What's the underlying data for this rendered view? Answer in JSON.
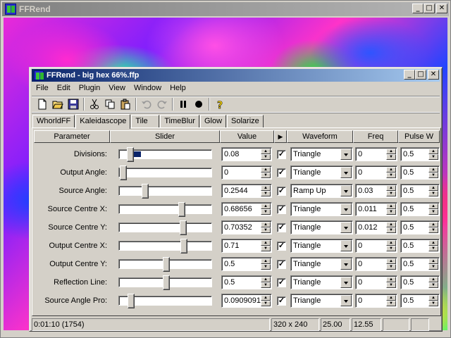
{
  "outer_window": {
    "title": "FFRend",
    "buttons": [
      "_",
      "□",
      "✕"
    ]
  },
  "window": {
    "title": "FFRend - big hex 66%.ffp",
    "buttons": [
      "_",
      "□",
      "✕"
    ]
  },
  "menu": [
    "File",
    "Edit",
    "Plugin",
    "View",
    "Window",
    "Help"
  ],
  "toolbar": [
    "new-file-icon",
    "open-folder-icon",
    "save-icon",
    "cut-icon",
    "copy-icon",
    "paste-icon",
    "undo-icon",
    "redo-icon",
    "pause-icon",
    "record-icon",
    "help-icon"
  ],
  "tabs": [
    "WhorldFF",
    "Kaleidascope",
    "Tile",
    "TimeBlur",
    "Glow",
    "Solarize"
  ],
  "active_tab": 1,
  "headers": {
    "parameter": "Parameter",
    "slider": "Slider",
    "value": "Value",
    "play": "▶",
    "waveform": "Waveform",
    "freq": "Freq",
    "pulse": "Pulse W"
  },
  "rows": [
    {
      "label": "Divisions:",
      "value": "0.08",
      "slider": 0.08,
      "checked": true,
      "waveform": "Triangle",
      "freq": "0",
      "pulse": "0.5",
      "selected": true
    },
    {
      "label": "Output Angle:",
      "value": "0",
      "slider": 0.0,
      "checked": true,
      "waveform": "Triangle",
      "freq": "0",
      "pulse": "0.5"
    },
    {
      "label": "Source Angle:",
      "value": "0.2544",
      "slider": 0.2544,
      "checked": true,
      "waveform": "Ramp Up",
      "freq": "0.03",
      "pulse": "0.5"
    },
    {
      "label": "Source Centre X:",
      "value": "0.68656",
      "slider": 0.68656,
      "checked": true,
      "waveform": "Triangle",
      "freq": "0.011",
      "pulse": "0.5"
    },
    {
      "label": "Source Centre Y:",
      "value": "0.70352",
      "slider": 0.70352,
      "checked": true,
      "waveform": "Triangle",
      "freq": "0.012",
      "pulse": "0.5"
    },
    {
      "label": "Output Centre X:",
      "value": "0.71",
      "slider": 0.71,
      "checked": true,
      "waveform": "Triangle",
      "freq": "0",
      "pulse": "0.5"
    },
    {
      "label": "Output Centre Y:",
      "value": "0.5",
      "slider": 0.5,
      "checked": true,
      "waveform": "Triangle",
      "freq": "0",
      "pulse": "0.5"
    },
    {
      "label": "Reflection Line:",
      "value": "0.5",
      "slider": 0.5,
      "checked": true,
      "waveform": "Triangle",
      "freq": "0",
      "pulse": "0.5"
    },
    {
      "label": "Source Angle Pro:",
      "value": "0.0909091",
      "slider": 0.0909091,
      "checked": true,
      "waveform": "Triangle",
      "freq": "0",
      "pulse": "0.5"
    }
  ],
  "status": {
    "time": "0:01:10 (1754)",
    "resolution": "320 x 240",
    "fps": "25.00",
    "rate": "12.55"
  }
}
